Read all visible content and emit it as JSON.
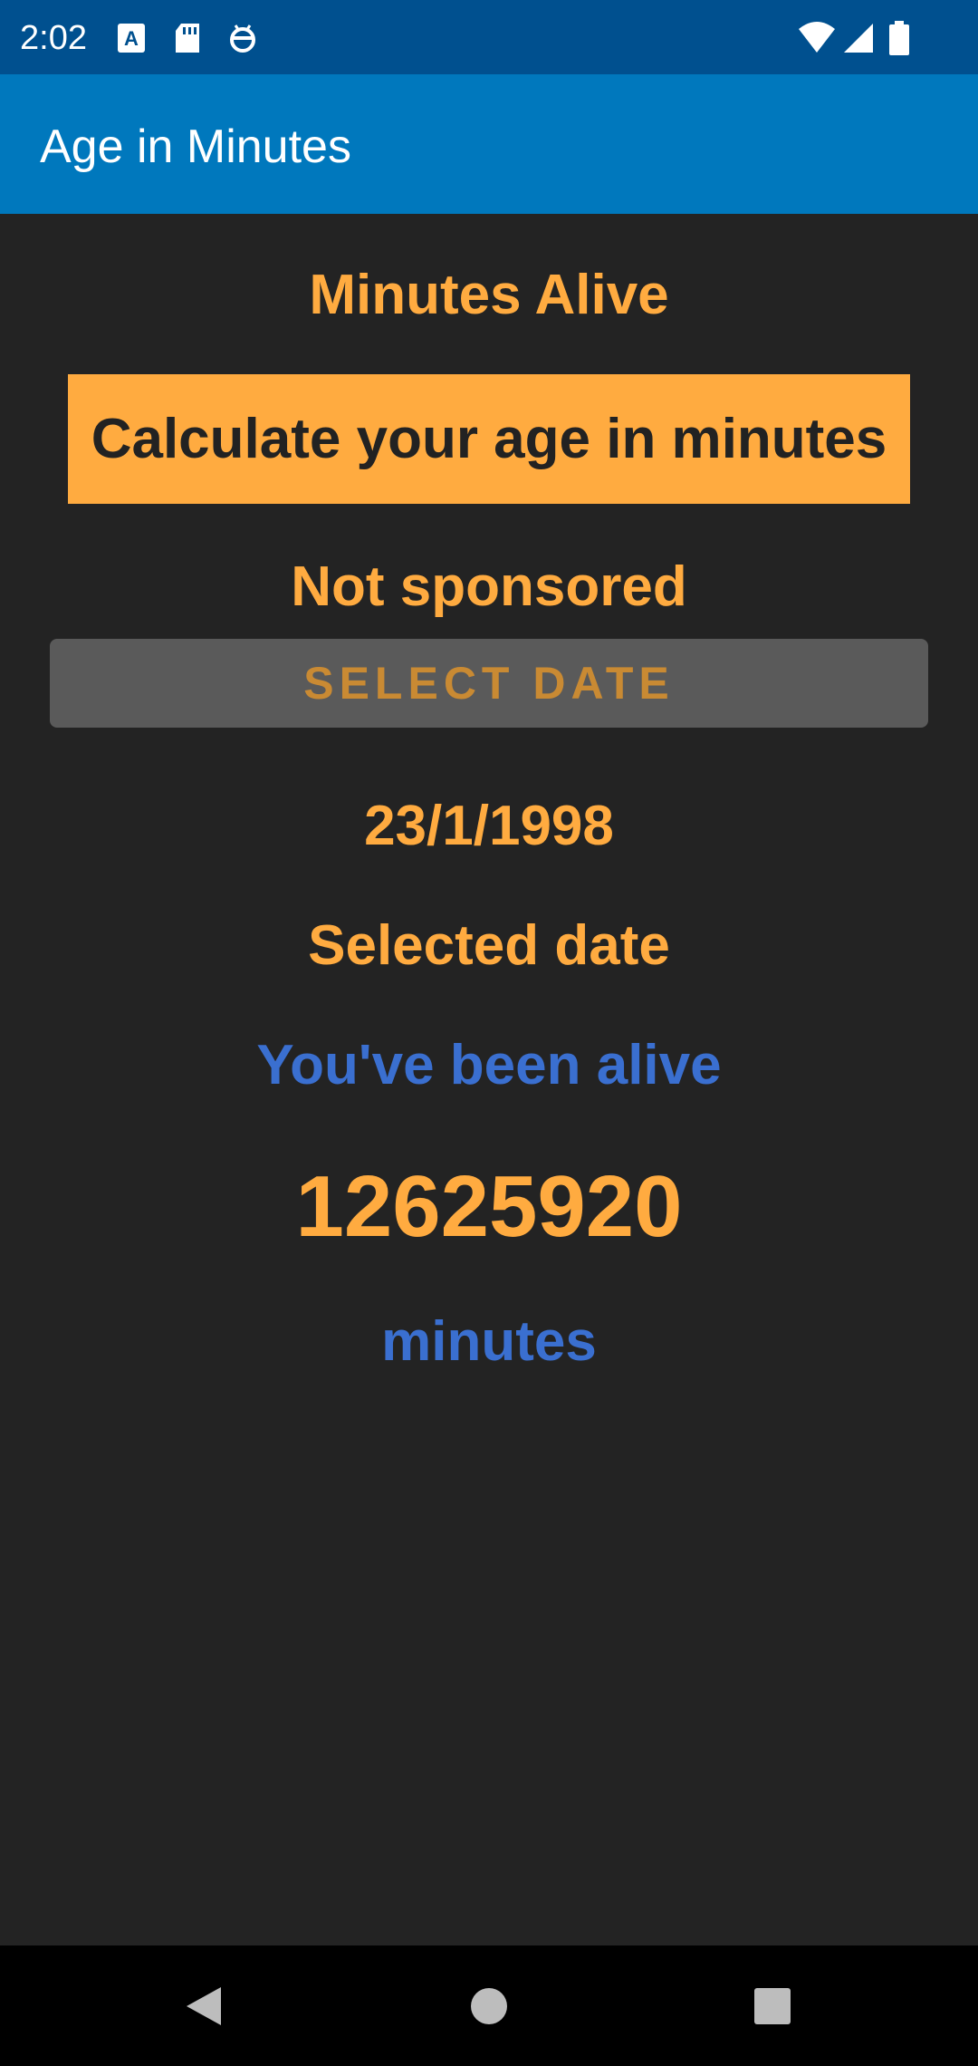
{
  "status_bar": {
    "time": "2:02",
    "icons_left": [
      "keyboard-a-icon",
      "sd-card-icon",
      "bug-icon"
    ],
    "icons_right": [
      "wifi-icon",
      "cell-signal-icon",
      "battery-icon"
    ]
  },
  "app_bar": {
    "title": "Age in Minutes",
    "color": "#0078bd"
  },
  "main": {
    "heading": "Minutes Alive",
    "banner": "Calculate your age in minutes",
    "sponsor": "Not sponsored",
    "select_date_label": "SELECT DATE",
    "date_value": "23/1/1998",
    "selected_label": "Selected date",
    "alive_label": "You've been alive",
    "minutes_value": "12625920",
    "minutes_unit": "minutes"
  },
  "nav_bar": {
    "buttons": [
      "back-icon",
      "home-icon",
      "recents-icon"
    ]
  },
  "colors": {
    "accent": "#ffab40",
    "blue_text": "#3a6fd0",
    "background": "#232323",
    "status_bar": "#00508f"
  }
}
